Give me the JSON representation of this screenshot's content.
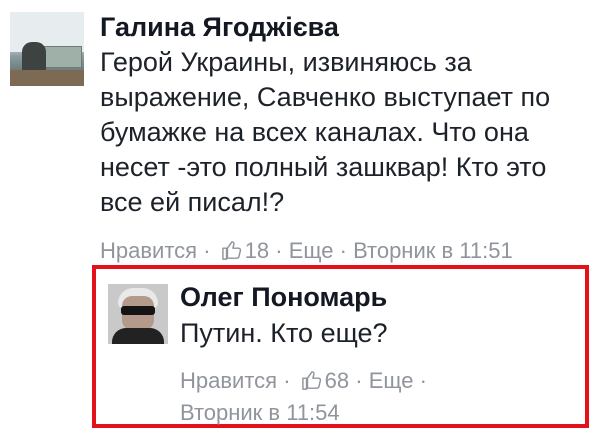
{
  "comment1": {
    "author": "Галина Ягоджієва",
    "text": "Герой Украины, извиняюсь за выражение, Савченко выступает по бумажке на всех каналах. Что она несет -это полный зашквар! Кто это все ей писал!?",
    "like_label": "Нравится",
    "like_count": "18",
    "reply_label": "Еще",
    "timestamp": "Вторник в 11:51"
  },
  "comment2": {
    "author": "Олег Пономарь",
    "text": "Путин. Кто еще?",
    "like_label": "Нравится",
    "like_count": "68",
    "reply_label": "Еще",
    "timestamp": "Вторник в 11:54"
  },
  "colors": {
    "highlight_border": "#e3121a",
    "meta_text": "#90949c",
    "author_text": "#141823"
  },
  "icons": {
    "like": "thumbs-up-icon"
  }
}
